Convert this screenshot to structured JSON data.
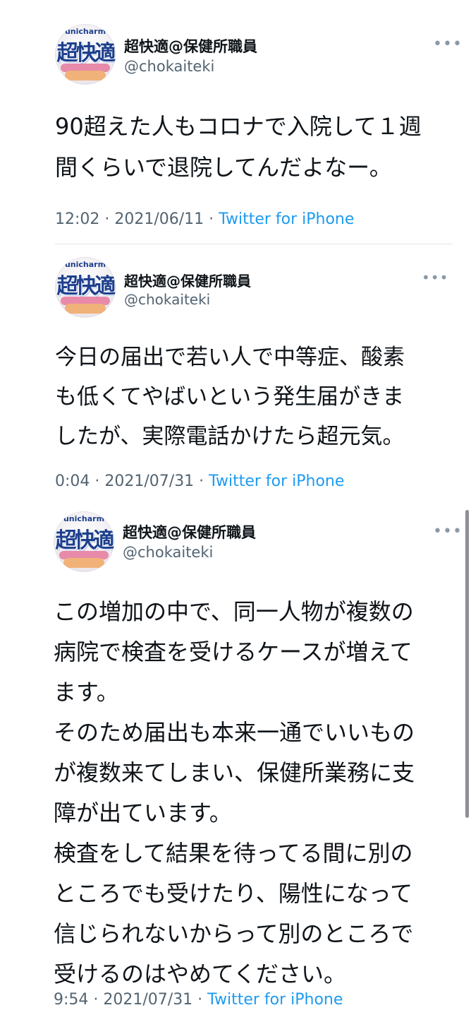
{
  "tweets": [
    {
      "avatar_brand": "unicharm",
      "avatar_logo": "超快適",
      "author_name": "超快適@保健所職員",
      "author_handle": "@chokaiteki",
      "more_label": "•••",
      "text": "90超えた人もコロナで入院して１週\n間くらいで退院してんだよなー。",
      "time": "12:02 · 2021/06/11 · ",
      "source": "Twitter for iPhone"
    },
    {
      "avatar_brand": "unicharm",
      "avatar_logo": "超快適",
      "author_name": "超快適@保健所職員",
      "author_handle": "@chokaiteki",
      "more_label": "•••",
      "text": "今日の届出で若い人で中等症、酸素\nも低くてやばいという発生届がきま\nしたが、実際電話かけたら超元気。",
      "time": "0:04 · 2021/07/31 · ",
      "source": "Twitter for iPhone"
    },
    {
      "avatar_brand": "unicharm",
      "avatar_logo": "超快適",
      "author_name": "超快適@保健所職員",
      "author_handle": "@chokaiteki",
      "more_label": "•••",
      "text": "この増加の中で、同一人物が複数の\n病院で検査を受けるケースが増えて\nます。\nそのため届出も本来一通でいいもの\nが複数来てしまい、保健所業務に支\n障が出ています。\n検査をして結果を待ってる間に別の\nところでも受けたり、陽性になって\n信じられないからって別のところで\n受けるのはやめてください。",
      "time": "9:54 · 2021/07/31 · ",
      "source": "Twitter for iPhone"
    }
  ],
  "colors": {
    "link": "#1d9bf0",
    "secondary_text": "#536471",
    "primary_text": "#0f1419"
  }
}
